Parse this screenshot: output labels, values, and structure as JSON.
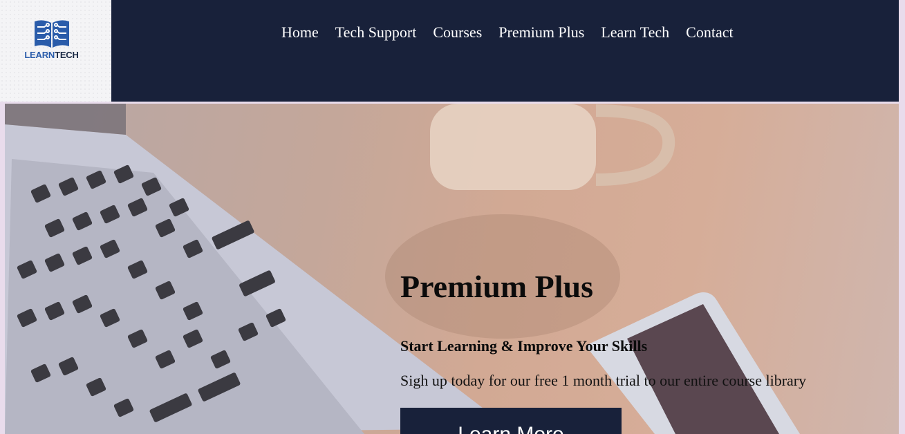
{
  "brand": {
    "logo_part1": "LEARN",
    "logo_part2": "TECH",
    "logo_icon": "circuit-book-icon"
  },
  "nav": {
    "items": [
      {
        "label": "Home"
      },
      {
        "label": "Tech Support"
      },
      {
        "label": "Courses"
      },
      {
        "label": "Premium Plus"
      },
      {
        "label": "Learn Tech"
      },
      {
        "label": "Contact"
      }
    ]
  },
  "hero": {
    "title": "Premium Plus",
    "subtitle": "Start Learning & Improve Your Skills",
    "description": "Sigh up today for our free 1 month trial to our entire course library",
    "cta_label": "Learn More",
    "background": "laptop-coffee-phone-photo"
  },
  "colors": {
    "header_bg": "#18213a",
    "logo_blue": "#2a5caa",
    "page_bg": "#e9dcec",
    "cta_bg": "#18213a"
  }
}
